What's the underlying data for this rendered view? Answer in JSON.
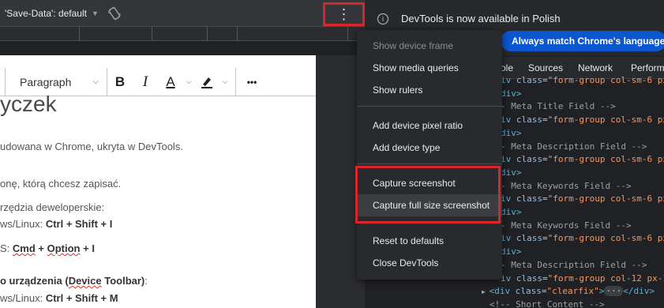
{
  "device_toolbar": {
    "save_data_label": "'Save-Data': default",
    "kebab_label": "⋮"
  },
  "editor": {
    "paragraph_label": "Paragraph",
    "bold_label": "B",
    "italic_label": "I",
    "text_color_label": "A",
    "more_label": "•••"
  },
  "page": {
    "heading": "yczek",
    "line1": "udowana w Chrome, ukryta w DevTools.",
    "line2": "onę, którą chcesz zapisać.",
    "line3": "rzędzia deweloperskie:",
    "line4_prefix": "ws/Linux: ",
    "line4_keys": "Ctrl + Shift + I",
    "line5_prefix": "S: ",
    "line5_key1": "Cmd",
    "line5_plus1": " + ",
    "line5_key2": "Option",
    "line5_rest": " + I",
    "line6_bold": "o urządzenia (",
    "line6_spell": "Device",
    "line6_bold2": " Toolbar)",
    "line6_colon": ":",
    "line7_prefix": "ws/Linux: ",
    "line7_keys": "Ctrl + Shift + M"
  },
  "devtools": {
    "infobar_text": "DevTools is now available in Polish",
    "match_language_button": "Always match Chrome's language",
    "tabs": [
      "ole",
      "Sources",
      "Network",
      "Perform"
    ]
  },
  "menu": {
    "items": [
      {
        "label": "Show device frame",
        "enabled": false
      },
      {
        "label": "Show media queries",
        "enabled": true
      },
      {
        "label": "Show rulers",
        "enabled": true
      },
      {
        "label": "Add device pixel ratio",
        "enabled": true
      },
      {
        "label": "Add device type",
        "enabled": true
      },
      {
        "label": "Capture screenshot",
        "enabled": true
      },
      {
        "label": "Capture full size screenshot",
        "enabled": true
      },
      {
        "label": "Reset to defaults",
        "enabled": true
      },
      {
        "label": "Close DevTools",
        "enabled": true
      }
    ]
  },
  "code_lines": [
    {
      "text": "iv class=\"form-group col-sm-6 px",
      "kind": "clipped"
    },
    {
      "text": "div>",
      "kind": "close"
    },
    {
      "text": "- Meta Title Field -->",
      "kind": "comment"
    },
    {
      "text": "iv class=\"form-group col-sm-6 px",
      "kind": "open"
    },
    {
      "text": "div>",
      "kind": "close"
    },
    {
      "text": "- Meta Description Field -->",
      "kind": "comment"
    },
    {
      "text": "iv class=\"form-group col-sm-6 px",
      "kind": "open"
    },
    {
      "text": "div>",
      "kind": "close"
    },
    {
      "text": "- Meta Keywords Field -->",
      "kind": "comment"
    },
    {
      "text": "iv class=\"form-group col-sm-6 px",
      "kind": "open"
    },
    {
      "text": "div>",
      "kind": "close"
    },
    {
      "text": "- Meta Keywords Field -->",
      "kind": "comment"
    },
    {
      "text": "iv class=\"form-group col-sm-6 px",
      "kind": "open"
    },
    {
      "text": "div>",
      "kind": "close"
    },
    {
      "text": "- Meta Description Field -->",
      "kind": "comment"
    },
    {
      "text": "iv class=\"form-group col-12 px-1",
      "kind": "open"
    },
    {
      "text": "<div class=\"clearfix\">",
      "kind": "clearfix"
    },
    {
      "text": "<!-- Short Content -->",
      "kind": "comment-last"
    }
  ],
  "colors": {
    "highlight_red": "#d9262c",
    "accent_blue": "#0b57d0",
    "menu_bg": "#292a2d"
  }
}
